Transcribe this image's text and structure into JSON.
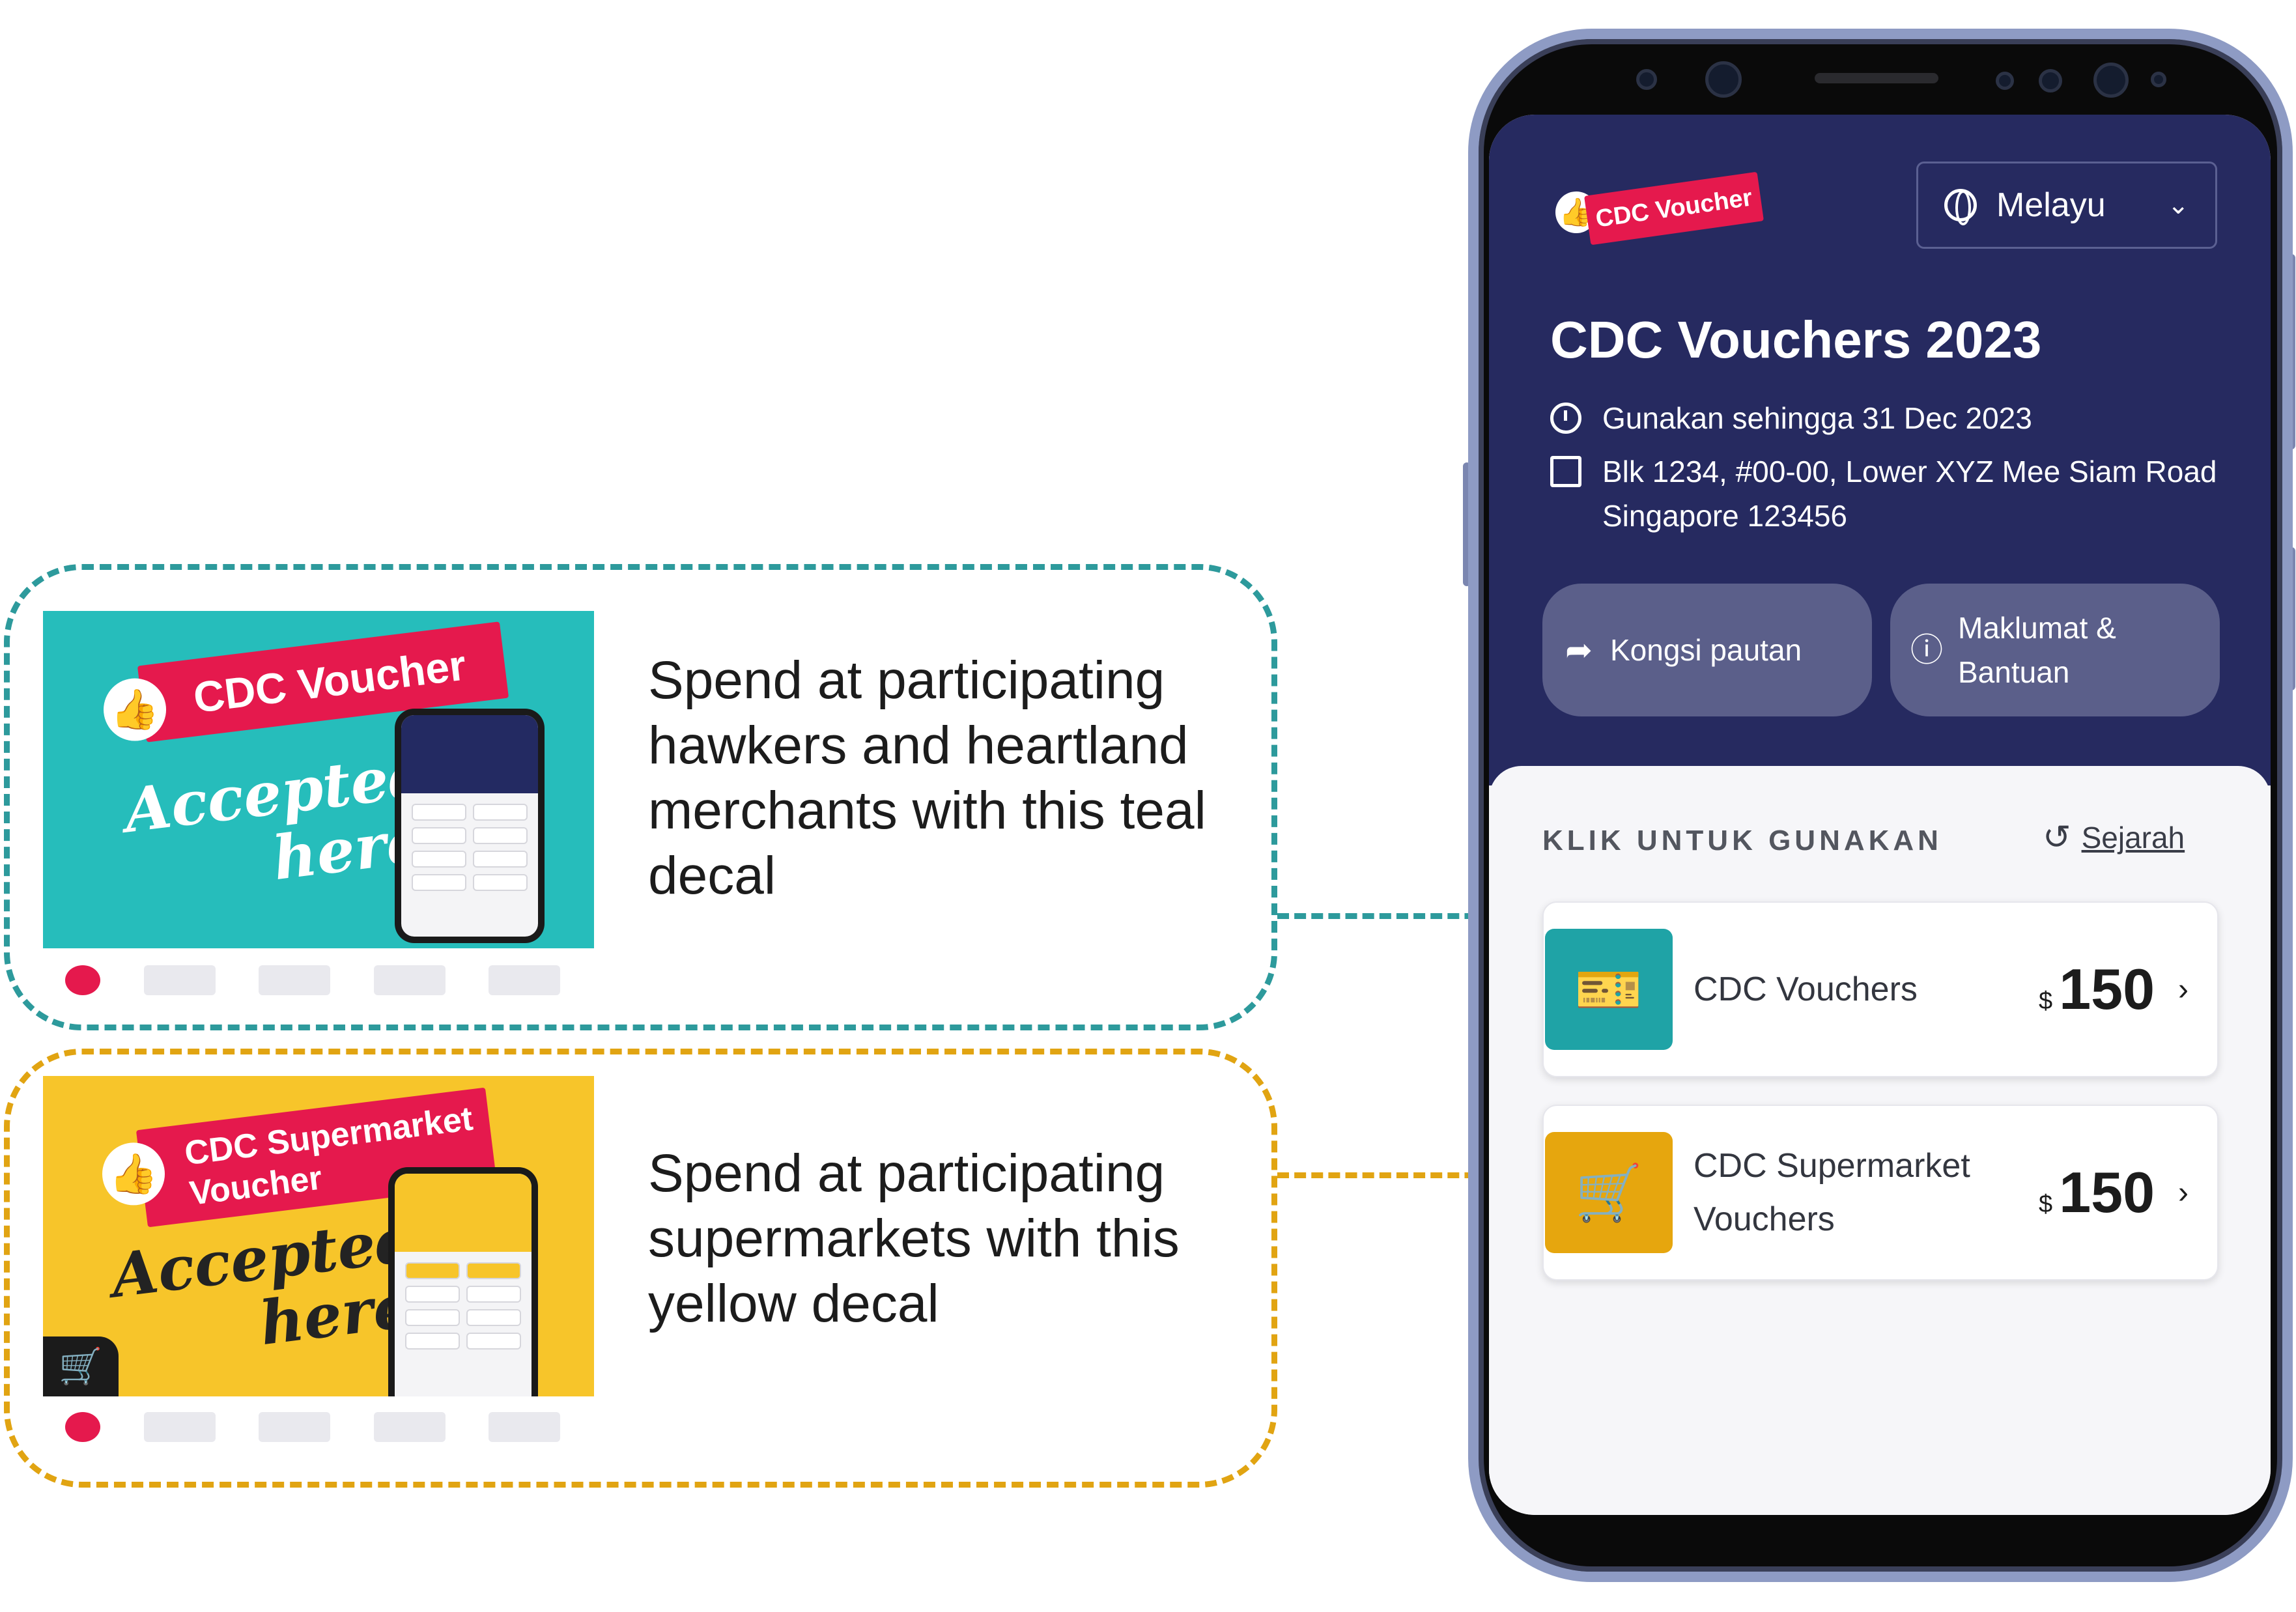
{
  "colors": {
    "teal": "#2d9a9c",
    "yellow": "#e1a412",
    "navy": "#262a60",
    "accent_red": "#e5194d"
  },
  "callouts": [
    {
      "decal_title": "CDC Voucher",
      "decal_accepted_line1": "Accepted",
      "decal_accepted_line2": "here",
      "description": "Spend at participating hawkers and heartland merchants with this teal decal"
    },
    {
      "decal_title": "CDC Supermarket Voucher",
      "decal_accepted_line1": "Accepted",
      "decal_accepted_line2": "here",
      "description": "Spend at participating supermarkets with this yellow decal"
    }
  ],
  "app": {
    "brand": "CDC Voucher",
    "language": "Melayu",
    "title": "CDC Vouchers 2023",
    "valid_until": "Gunakan sehingga 31 Dec 2023",
    "address": "Blk 1234, #00-00, Lower XYZ Mee Siam Road Singapore 123456",
    "share_button": "Kongsi pautan",
    "help_button": "Maklumat & Bantuan",
    "section_label": "KLIK UNTUK GUNAKAN",
    "history_link": "Sejarah",
    "vouchers": [
      {
        "label": "CDC Vouchers",
        "currency": "$",
        "amount": "150",
        "icon": "ticket-dollar-icon"
      },
      {
        "label": "CDC Supermarket Vouchers",
        "currency": "$",
        "amount": "150",
        "icon": "shopping-cart-icon"
      }
    ]
  }
}
